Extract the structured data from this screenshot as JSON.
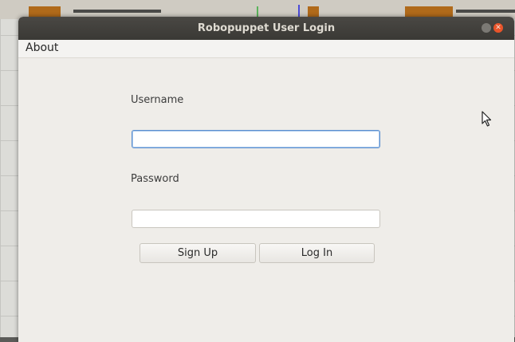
{
  "window": {
    "title": "Robopuppet User Login"
  },
  "menubar": {
    "items": [
      {
        "label": "About"
      }
    ]
  },
  "form": {
    "username_label": "Username",
    "username_value": "",
    "password_label": "Password",
    "password_value": ""
  },
  "buttons": {
    "signup_label": "Sign Up",
    "login_label": "Log In"
  },
  "titlebar_controls": {
    "close_glyph": "✕"
  },
  "colors": {
    "titlebar": "#3f3d39",
    "window_bg": "#efede9",
    "close_button": "#e9542a",
    "focus_border": "#5b8fcf"
  },
  "icons": [
    "minimize-icon",
    "close-icon",
    "mouse-pointer-icon"
  ]
}
